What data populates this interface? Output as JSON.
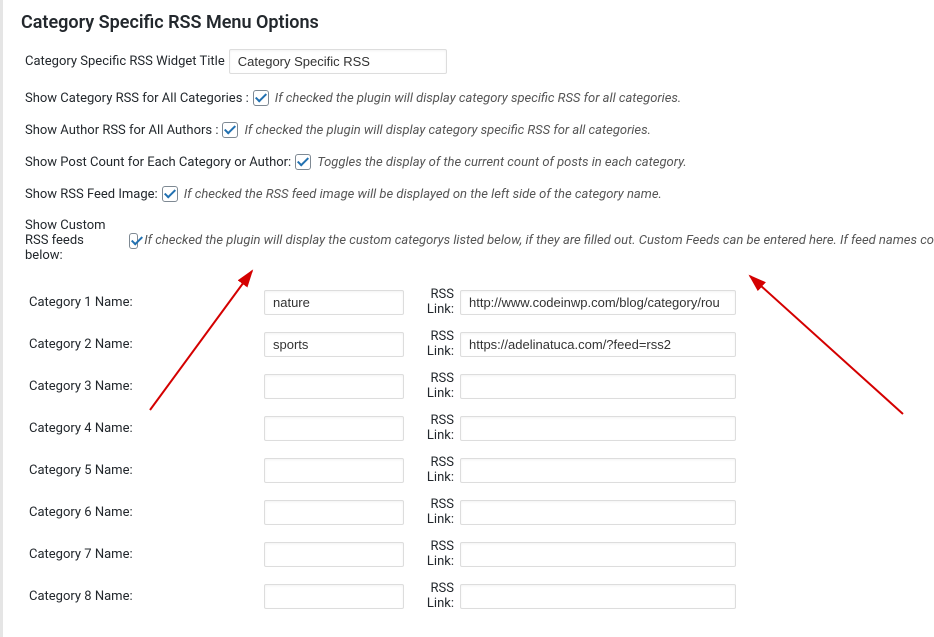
{
  "page_title": "Category Specific RSS Menu Options",
  "widget_title_label": "Category Specific RSS Widget Title",
  "widget_title_value": "Category Specific RSS",
  "options": [
    {
      "label": "Show Category RSS for All Categories :",
      "checked": true,
      "hint": "If checked the plugin will display category specific RSS for all categories."
    },
    {
      "label": "Show Author RSS for All Authors :",
      "checked": true,
      "hint": "If checked the plugin will display category specific RSS for all categories."
    },
    {
      "label": "Show Post Count for Each Category or Author:",
      "checked": true,
      "hint": "Toggles the display of the current count of posts in each category."
    },
    {
      "label": "Show RSS Feed Image:",
      "checked": true,
      "hint": "If checked the RSS feed image will be displayed on the left side of the category name."
    },
    {
      "label": "Show Custom RSS feeds below:",
      "checked": true,
      "hint": "If checked the plugin will display the custom categorys listed below, if they are filled out. Custom Feeds can be entered here. If feed names co"
    }
  ],
  "rss_link_label": "RSS Link:",
  "categories": [
    {
      "label": "Category 1 Name:",
      "name": "nature",
      "link": "http://www.codeinwp.com/blog/category/rou"
    },
    {
      "label": "Category 2 Name:",
      "name": "sports",
      "link": "https://adelinatuca.com/?feed=rss2"
    },
    {
      "label": "Category 3 Name:",
      "name": "",
      "link": ""
    },
    {
      "label": "Category 4 Name:",
      "name": "",
      "link": ""
    },
    {
      "label": "Category 5 Name:",
      "name": "",
      "link": ""
    },
    {
      "label": "Category 6 Name:",
      "name": "",
      "link": ""
    },
    {
      "label": "Category 7 Name:",
      "name": "",
      "link": ""
    },
    {
      "label": "Category 8 Name:",
      "name": "",
      "link": ""
    }
  ]
}
